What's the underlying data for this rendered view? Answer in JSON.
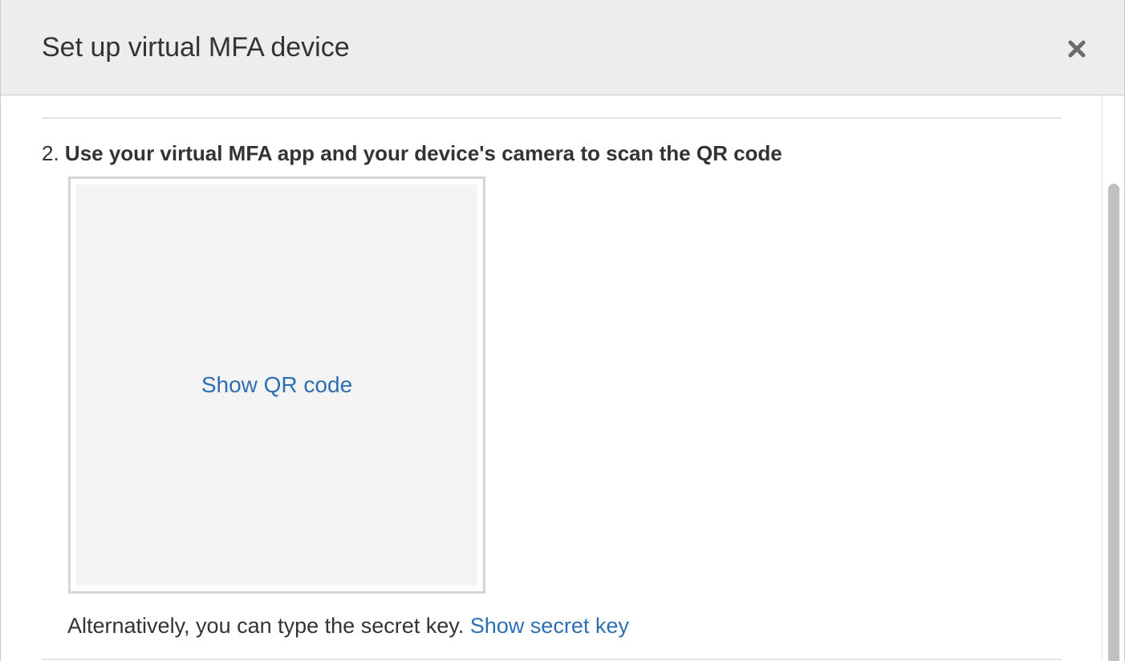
{
  "dialog": {
    "title": "Set up virtual MFA device",
    "close_icon": "close-icon"
  },
  "step": {
    "number": "2.",
    "text": "Use your virtual MFA app and your device's camera to scan the QR code"
  },
  "qr": {
    "show_label": "Show QR code"
  },
  "secret": {
    "prompt": "Alternatively, you can type the secret key.",
    "show_label": "Show secret key"
  },
  "colors": {
    "link": "#2e6fb3",
    "header_bg": "#ededed",
    "text": "#333333"
  }
}
